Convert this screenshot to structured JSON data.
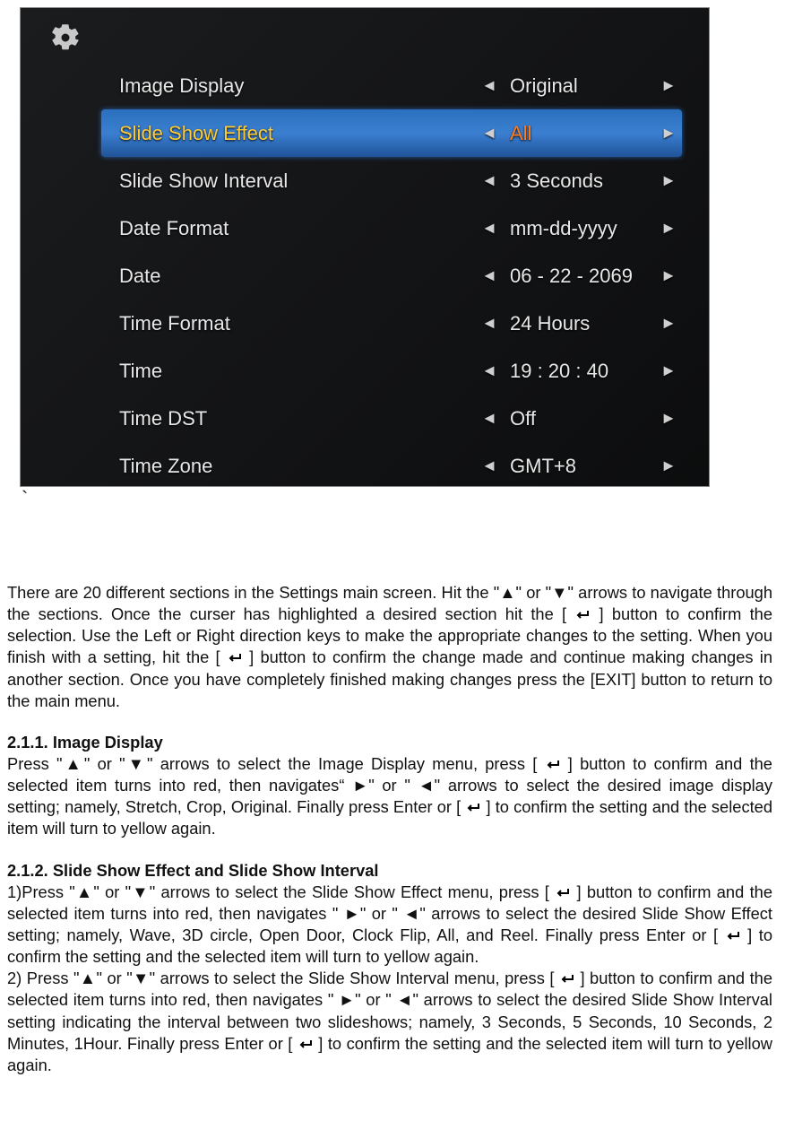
{
  "settings": {
    "rows": [
      {
        "label": "Image Display",
        "value": "Original",
        "selected": false
      },
      {
        "label": "Slide Show Effect",
        "value": "All",
        "selected": true
      },
      {
        "label": "Slide Show Interval",
        "value": "3 Seconds",
        "selected": false
      },
      {
        "label": "Date Format",
        "value": "mm-dd-yyyy",
        "selected": false
      },
      {
        "label": "Date",
        "value": "06 - 22 - 2069",
        "selected": false
      },
      {
        "label": "Time Format",
        "value": "24 Hours",
        "selected": false
      },
      {
        "label": "Time",
        "value": "19 : 20 : 40",
        "selected": false
      },
      {
        "label": "Time DST",
        "value": "Off",
        "selected": false
      },
      {
        "label": "Time Zone",
        "value": "GMT+8",
        "selected": false
      }
    ]
  },
  "glyphs": {
    "left": "◄",
    "right": "►",
    "backtick": "`"
  },
  "doc": {
    "p1a": "There are 20 different sections in the Settings main screen. Hit the \"▲\" or \"▼\" arrows to navigate through the sections. Once the curser has highlighted a desired section hit the [ ",
    "p1b": " ] button to confirm the selection. Use the Left or Right direction keys to make the appropriate changes to the setting. When you finish with a setting, hit the [ ",
    "p1c": " ] button to confirm the change made and continue making changes in another section. Once you have completely finished making changes press the [EXIT] button to return to the main menu.",
    "h1": "2.1.1. Image Display",
    "p2a": "Press \"▲\" or \"▼\" arrows to select the Image Display menu, press [ ",
    "p2b": " ] button to confirm and the selected item turns into red, then navigates“ ►\" or \"  ◄\" arrows to select the desired image display setting; namely, Stretch, Crop, Original. Finally press Enter or [ ",
    "p2c": " ] to confirm the setting and the selected item will turn to yellow again.",
    "h2": "2.1.2. Slide Show Effect and Slide Show Interval",
    "p3a": "1)Press \"▲\" or \"▼\" arrows to select the Slide Show Effect menu, press [ ",
    "p3b": " ] button to confirm and the selected item turns into red, then navigates \" ►\" or \"  ◄\" arrows to select the desired Slide Show Effect setting; namely, Wave, 3D circle, Open Door, Clock Flip, All, and Reel. Finally press Enter or [ ",
    "p3c": " ] to confirm the setting and the selected item will turn to yellow again.",
    "p4a": "2) Press \"▲\" or \"▼\" arrows to select the Slide Show Interval menu, press [ ",
    "p4b": " ] button to confirm and the selected item turns into red, then navigates \" ►\" or \"  ◄\" arrows to select the desired Slide Show Interval setting indicating the interval between two slideshows; namely, 3 Seconds, 5 Seconds, 10 Seconds, 2 Minutes, 1Hour. Finally press Enter or [ ",
    "p4c": " ] to confirm the setting and the selected item will turn to yellow again."
  }
}
